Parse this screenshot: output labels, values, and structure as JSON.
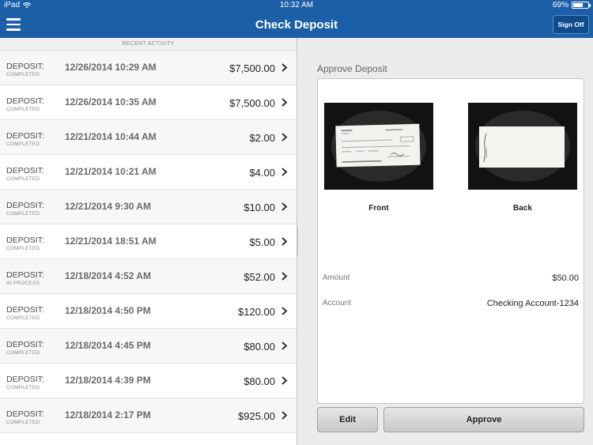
{
  "status_bar": {
    "device": "iPad",
    "time": "10:32 AM",
    "battery_text": "69%",
    "battery_level": 0.69
  },
  "nav": {
    "title": "Check Deposit",
    "sign_off_label": "Sign Off"
  },
  "left": {
    "section_header": "RECENT ACTIVITY",
    "rows": [
      {
        "type": "DEPOSIT:",
        "status": "COMPLETED",
        "date": "12/26/2014 10:29 AM",
        "amount": "$7,500.00"
      },
      {
        "type": "DEPOSIT:",
        "status": "COMPLETED",
        "date": "12/26/2014 10:35 AM",
        "amount": "$7,500.00"
      },
      {
        "type": "DEPOSIT:",
        "status": "COMPLETED",
        "date": "12/21/2014 10:44 AM",
        "amount": "$2.00"
      },
      {
        "type": "DEPOSIT:",
        "status": "COMPLETED",
        "date": "12/21/2014 10:21 AM",
        "amount": "$4.00"
      },
      {
        "type": "DEPOSIT:",
        "status": "COMPLETED",
        "date": "12/21/2014 9:30 AM",
        "amount": "$10.00"
      },
      {
        "type": "DEPOSIT:",
        "status": "COMPLETED",
        "date": "12/21/2014 18:51 AM",
        "amount": "$5.00"
      },
      {
        "type": "DEPOSIT:",
        "status": "IN PROCESS",
        "date": "12/18/2014 4:52 AM",
        "amount": "$52.00"
      },
      {
        "type": "DEPOSIT:",
        "status": "COMPLETED",
        "date": "12/18/2014 4:50 PM",
        "amount": "$120.00"
      },
      {
        "type": "DEPOSIT:",
        "status": "COMPLETED",
        "date": "12/18/2014 4:45 PM",
        "amount": "$80.00"
      },
      {
        "type": "DEPOSIT:",
        "status": "COMPLETED",
        "date": "12/18/2014 4:39 PM",
        "amount": "$80.00"
      },
      {
        "type": "DEPOSIT:",
        "status": "COMPLETED",
        "date": "12/18/2014 2:17 PM",
        "amount": "$925.00"
      }
    ]
  },
  "right": {
    "title": "Approve Deposit",
    "front_caption": "Front",
    "back_caption": "Back",
    "amount_label": "Amount",
    "amount_value": "$50.00",
    "account_label": "Account",
    "account_value": "Checking Account-1234",
    "edit_label": "Edit",
    "approve_label": "Approve"
  },
  "colors": {
    "nav_blue": "#1a5fa8",
    "sign_off_bg": "#0f4c8e"
  },
  "icons": {
    "menu": "hamburger-icon",
    "row_chevron": "chevron-right-icon",
    "wifi": "wifi-icon",
    "battery": "battery-icon",
    "handle": "drag-handle-icon"
  }
}
